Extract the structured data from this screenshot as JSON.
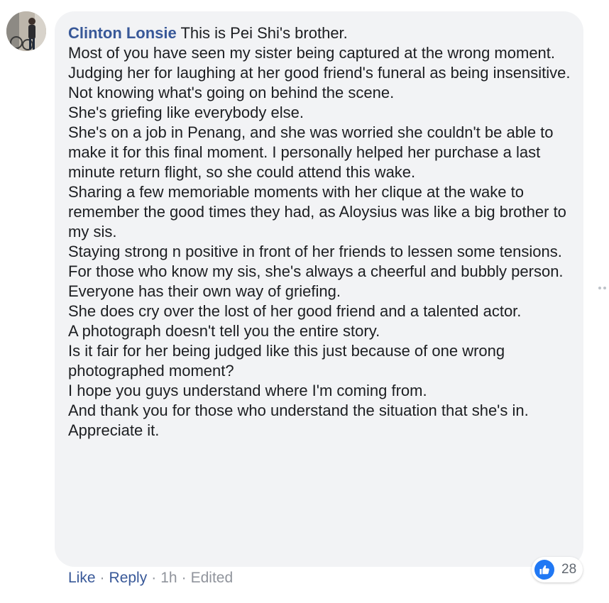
{
  "comment": {
    "author": "Clinton Lonsie",
    "lines": [
      "This is Pei Shi's brother.",
      "Most of you have seen my sister being captured at the wrong moment.",
      "Judging her for laughing at her good friend's funeral as being insensitive.",
      "Not knowing what's going on behind the scene.",
      "She's griefing like everybody else.",
      "She's on a job in Penang, and she was worried she couldn't be able to make it for this final moment. I personally helped her purchase a last minute return flight, so she could attend this wake.",
      "Sharing a few memoriable moments with her clique at the wake to remember the good times they had, as Aloysius was like a big brother to my sis.",
      "Staying strong n positive in front of her friends to lessen some tensions.",
      "For those who know my sis, she's always a cheerful and bubbly person.",
      "Everyone has their own way of griefing.",
      "She does cry over the lost of her good friend and a talented actor.",
      "A photograph doesn't tell you the entire story.",
      "Is it fair for her being judged like this just because of one wrong photographed moment?",
      "I hope you guys understand where I'm coming from.",
      "And thank you for those who understand the situation that she's in. Appreciate it."
    ]
  },
  "actions": {
    "like": "Like",
    "reply": "Reply",
    "time": "1h",
    "edited": "Edited",
    "separator": "·"
  },
  "reactions": {
    "icon": "thumbs-up-icon",
    "count": "28"
  },
  "colors": {
    "author": "#385898",
    "bubble": "#f2f3f5",
    "like_badge": "#2078f4",
    "meta": "#90949c"
  }
}
